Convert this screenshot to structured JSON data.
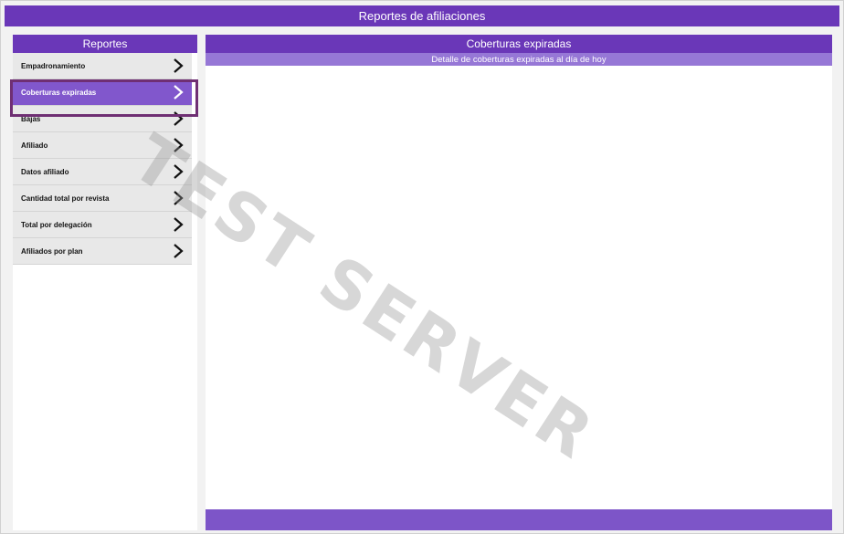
{
  "header": {
    "title": "Reportes de afiliaciones"
  },
  "sidebar": {
    "title": "Reportes",
    "items": [
      {
        "label": "Empadronamiento",
        "icon": "chevron-right-icon"
      },
      {
        "label": "Coberturas expiradas",
        "icon": "chevron-right-icon",
        "active": true
      },
      {
        "label": "Bajas",
        "icon": "chevron-right-icon"
      },
      {
        "label": "Afiliado",
        "icon": "chevron-right-icon"
      },
      {
        "label": "Datos afiliado",
        "icon": "chevron-right-icon"
      },
      {
        "label": "Cantidad total por revista",
        "icon": "chevron-right-icon"
      },
      {
        "label": "Total por delegación",
        "icon": "chevron-right-icon"
      },
      {
        "label": "Afiliados por plan",
        "icon": "chevron-right-icon"
      }
    ]
  },
  "content": {
    "title": "Coberturas expiradas",
    "subtitle": "Detalle de coberturas expiradas al día de hoy"
  },
  "watermark": {
    "text": "TEST SERVER"
  },
  "colors": {
    "primary": "#6a37b8",
    "subheader": "#9677d6",
    "active_item": "#8157cc",
    "active_outline": "#6f2f73",
    "menu_bg": "#e8e8e8"
  }
}
